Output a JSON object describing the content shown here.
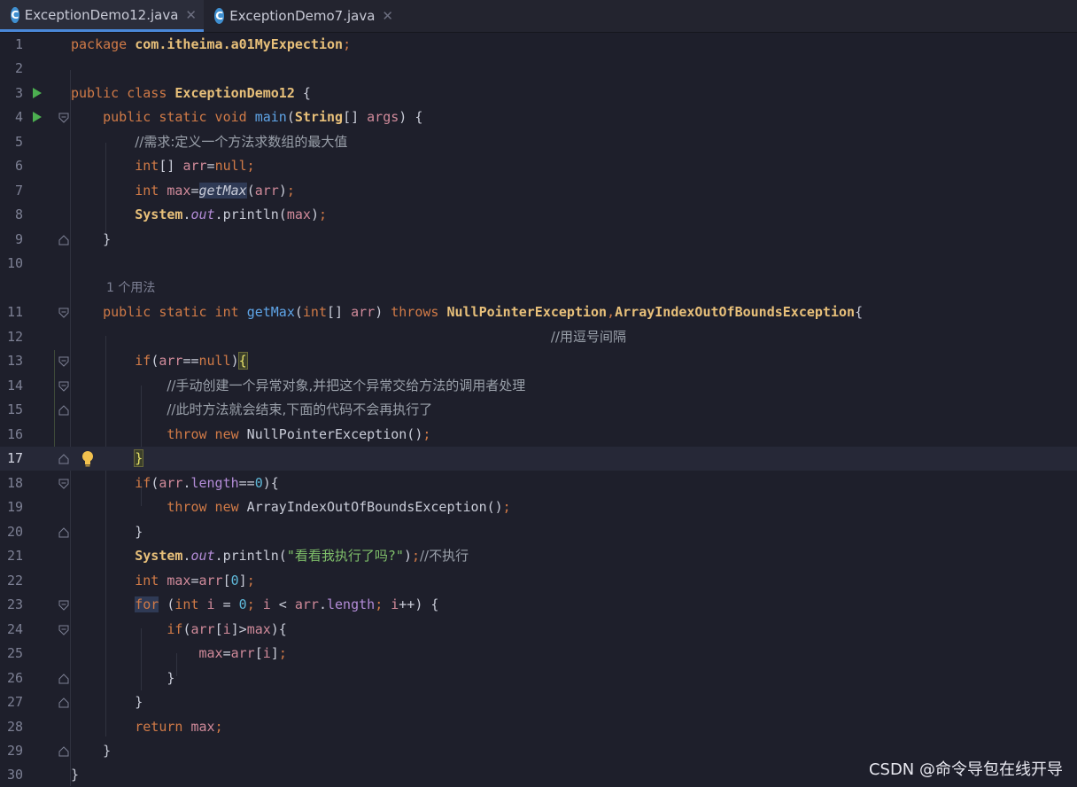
{
  "tabs": [
    {
      "label": "ExceptionDemo12.java",
      "icon": "java-class-icon",
      "active": true
    },
    {
      "label": "ExceptionDemo7.java",
      "icon": "java-class-icon",
      "active": false
    }
  ],
  "editor": {
    "current_line": "17",
    "usage_hint": "1 个用法",
    "lines": [
      {
        "n": "1",
        "text": "package com.itheima.a01MyExpection;"
      },
      {
        "n": "2",
        "text": ""
      },
      {
        "n": "3",
        "text": "public class ExceptionDemo12 {"
      },
      {
        "n": "4",
        "text": "    public static void main(String[] args) {"
      },
      {
        "n": "5",
        "text": "        //需求:定义一个方法求数组的最大值"
      },
      {
        "n": "6",
        "text": "        int[] arr=null;"
      },
      {
        "n": "7",
        "text": "        int max=getMax(arr);"
      },
      {
        "n": "8",
        "text": "        System.out.println(max);"
      },
      {
        "n": "9",
        "text": "    }"
      },
      {
        "n": "10",
        "text": ""
      },
      {
        "n": "11",
        "text": "    public static int getMax(int[] arr) throws NullPointerException,ArrayIndexOutOfBoundsException{"
      },
      {
        "n": "12",
        "text": "                                                            //用逗号间隔"
      },
      {
        "n": "13",
        "text": "        if(arr==null){"
      },
      {
        "n": "14",
        "text": "            //手动创建一个异常对象,并把这个异常交给方法的调用者处理"
      },
      {
        "n": "15",
        "text": "            //此时方法就会结束,下面的代码不会再执行了"
      },
      {
        "n": "16",
        "text": "            throw new NullPointerException();"
      },
      {
        "n": "17",
        "text": "        }"
      },
      {
        "n": "18",
        "text": "        if(arr.length==0){"
      },
      {
        "n": "19",
        "text": "            throw new ArrayIndexOutOfBoundsException();"
      },
      {
        "n": "20",
        "text": "        }"
      },
      {
        "n": "21",
        "text": "        System.out.println(\"看看我执行了吗?\");//不执行"
      },
      {
        "n": "22",
        "text": "        int max=arr[0];"
      },
      {
        "n": "23",
        "text": "        for (int i = 0; i < arr.length; i++) {"
      },
      {
        "n": "24",
        "text": "            if(arr[i]>max){"
      },
      {
        "n": "25",
        "text": "                max=arr[i];"
      },
      {
        "n": "26",
        "text": "            }"
      },
      {
        "n": "27",
        "text": "        }"
      },
      {
        "n": "28",
        "text": "        return max;"
      },
      {
        "n": "29",
        "text": "    }"
      },
      {
        "n": "30",
        "text": "}"
      }
    ]
  },
  "watermark": "CSDN @命令导包在线开导",
  "colors": {
    "background": "#1e1f2b",
    "keyword": "#d07a47",
    "class": "#e8c07a",
    "method": "#5fa5e8",
    "comment": "#9aa0aa",
    "string": "#7fbf6a",
    "number": "#5fb8d8"
  }
}
